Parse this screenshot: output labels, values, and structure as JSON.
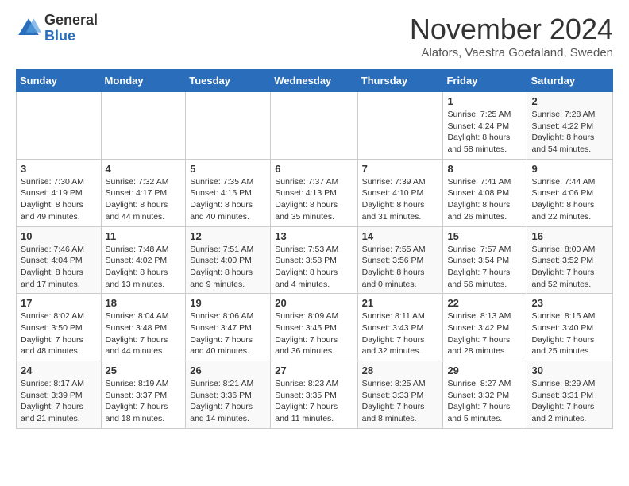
{
  "logo": {
    "general": "General",
    "blue": "Blue"
  },
  "header": {
    "title": "November 2024",
    "location": "Alafors, Vaestra Goetaland, Sweden"
  },
  "days_of_week": [
    "Sunday",
    "Monday",
    "Tuesday",
    "Wednesday",
    "Thursday",
    "Friday",
    "Saturday"
  ],
  "weeks": [
    [
      {
        "day": "",
        "info": ""
      },
      {
        "day": "",
        "info": ""
      },
      {
        "day": "",
        "info": ""
      },
      {
        "day": "",
        "info": ""
      },
      {
        "day": "",
        "info": ""
      },
      {
        "day": "1",
        "info": "Sunrise: 7:25 AM\nSunset: 4:24 PM\nDaylight: 8 hours and 58 minutes."
      },
      {
        "day": "2",
        "info": "Sunrise: 7:28 AM\nSunset: 4:22 PM\nDaylight: 8 hours and 54 minutes."
      }
    ],
    [
      {
        "day": "3",
        "info": "Sunrise: 7:30 AM\nSunset: 4:19 PM\nDaylight: 8 hours and 49 minutes."
      },
      {
        "day": "4",
        "info": "Sunrise: 7:32 AM\nSunset: 4:17 PM\nDaylight: 8 hours and 44 minutes."
      },
      {
        "day": "5",
        "info": "Sunrise: 7:35 AM\nSunset: 4:15 PM\nDaylight: 8 hours and 40 minutes."
      },
      {
        "day": "6",
        "info": "Sunrise: 7:37 AM\nSunset: 4:13 PM\nDaylight: 8 hours and 35 minutes."
      },
      {
        "day": "7",
        "info": "Sunrise: 7:39 AM\nSunset: 4:10 PM\nDaylight: 8 hours and 31 minutes."
      },
      {
        "day": "8",
        "info": "Sunrise: 7:41 AM\nSunset: 4:08 PM\nDaylight: 8 hours and 26 minutes."
      },
      {
        "day": "9",
        "info": "Sunrise: 7:44 AM\nSunset: 4:06 PM\nDaylight: 8 hours and 22 minutes."
      }
    ],
    [
      {
        "day": "10",
        "info": "Sunrise: 7:46 AM\nSunset: 4:04 PM\nDaylight: 8 hours and 17 minutes."
      },
      {
        "day": "11",
        "info": "Sunrise: 7:48 AM\nSunset: 4:02 PM\nDaylight: 8 hours and 13 minutes."
      },
      {
        "day": "12",
        "info": "Sunrise: 7:51 AM\nSunset: 4:00 PM\nDaylight: 8 hours and 9 minutes."
      },
      {
        "day": "13",
        "info": "Sunrise: 7:53 AM\nSunset: 3:58 PM\nDaylight: 8 hours and 4 minutes."
      },
      {
        "day": "14",
        "info": "Sunrise: 7:55 AM\nSunset: 3:56 PM\nDaylight: 8 hours and 0 minutes."
      },
      {
        "day": "15",
        "info": "Sunrise: 7:57 AM\nSunset: 3:54 PM\nDaylight: 7 hours and 56 minutes."
      },
      {
        "day": "16",
        "info": "Sunrise: 8:00 AM\nSunset: 3:52 PM\nDaylight: 7 hours and 52 minutes."
      }
    ],
    [
      {
        "day": "17",
        "info": "Sunrise: 8:02 AM\nSunset: 3:50 PM\nDaylight: 7 hours and 48 minutes."
      },
      {
        "day": "18",
        "info": "Sunrise: 8:04 AM\nSunset: 3:48 PM\nDaylight: 7 hours and 44 minutes."
      },
      {
        "day": "19",
        "info": "Sunrise: 8:06 AM\nSunset: 3:47 PM\nDaylight: 7 hours and 40 minutes."
      },
      {
        "day": "20",
        "info": "Sunrise: 8:09 AM\nSunset: 3:45 PM\nDaylight: 7 hours and 36 minutes."
      },
      {
        "day": "21",
        "info": "Sunrise: 8:11 AM\nSunset: 3:43 PM\nDaylight: 7 hours and 32 minutes."
      },
      {
        "day": "22",
        "info": "Sunrise: 8:13 AM\nSunset: 3:42 PM\nDaylight: 7 hours and 28 minutes."
      },
      {
        "day": "23",
        "info": "Sunrise: 8:15 AM\nSunset: 3:40 PM\nDaylight: 7 hours and 25 minutes."
      }
    ],
    [
      {
        "day": "24",
        "info": "Sunrise: 8:17 AM\nSunset: 3:39 PM\nDaylight: 7 hours and 21 minutes."
      },
      {
        "day": "25",
        "info": "Sunrise: 8:19 AM\nSunset: 3:37 PM\nDaylight: 7 hours and 18 minutes."
      },
      {
        "day": "26",
        "info": "Sunrise: 8:21 AM\nSunset: 3:36 PM\nDaylight: 7 hours and 14 minutes."
      },
      {
        "day": "27",
        "info": "Sunrise: 8:23 AM\nSunset: 3:35 PM\nDaylight: 7 hours and 11 minutes."
      },
      {
        "day": "28",
        "info": "Sunrise: 8:25 AM\nSunset: 3:33 PM\nDaylight: 7 hours and 8 minutes."
      },
      {
        "day": "29",
        "info": "Sunrise: 8:27 AM\nSunset: 3:32 PM\nDaylight: 7 hours and 5 minutes."
      },
      {
        "day": "30",
        "info": "Sunrise: 8:29 AM\nSunset: 3:31 PM\nDaylight: 7 hours and 2 minutes."
      }
    ]
  ]
}
